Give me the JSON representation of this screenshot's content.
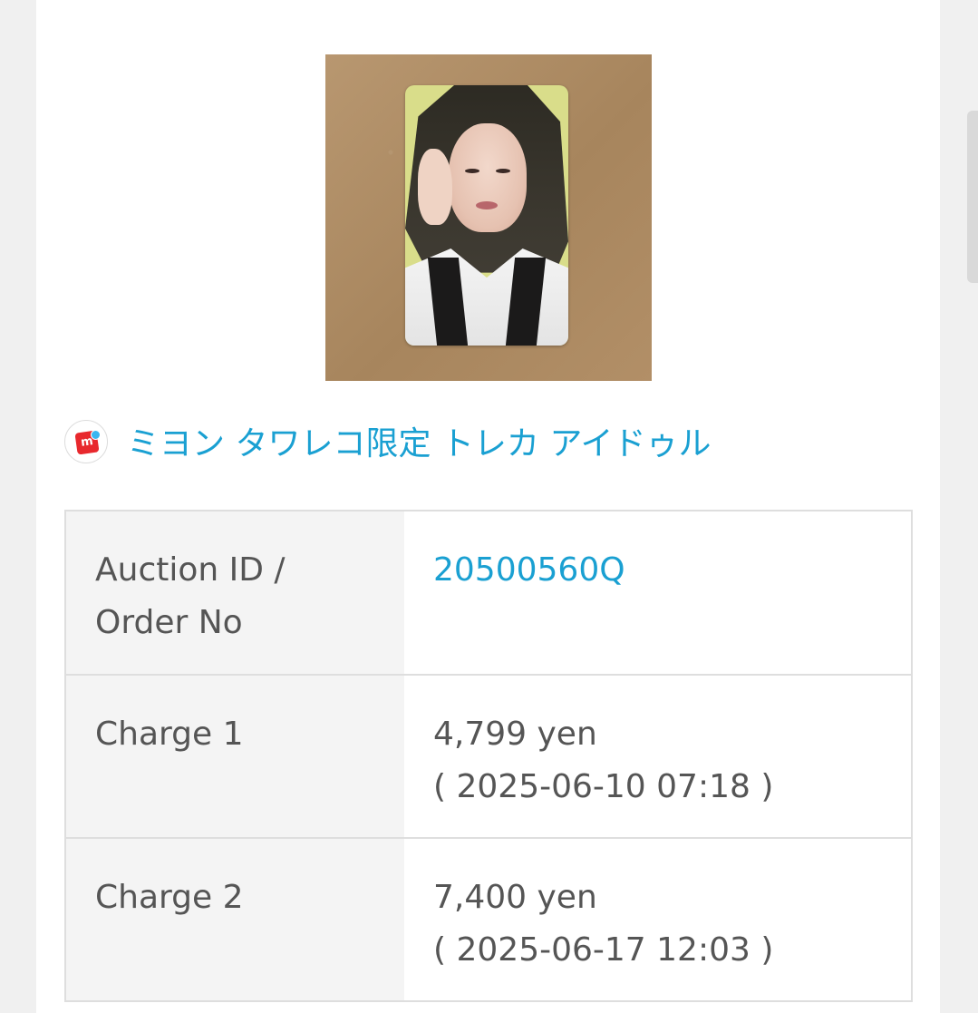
{
  "product": {
    "image_alt": "photocard of idol in black veil and white shirt on kraft paper",
    "shop_icon": "mercari-logo-icon",
    "title": "ミヨン タワレコ限定 トレカ アイドゥル"
  },
  "details": [
    {
      "label": "Auction ID / Order No",
      "value": "20500560Q"
    },
    {
      "label": "Charge 1",
      "amount": "4,799 yen",
      "date": "( 2025-06-10 07:18 )"
    },
    {
      "label": "Charge 2",
      "amount": "7,400 yen",
      "date": "( 2025-06-17 12:03 )"
    }
  ],
  "colors": {
    "accent": "#1aa0d2",
    "label_bg": "#f4f4f4",
    "border": "#dedede",
    "text": "#555555",
    "brand_red": "#e8282d"
  }
}
